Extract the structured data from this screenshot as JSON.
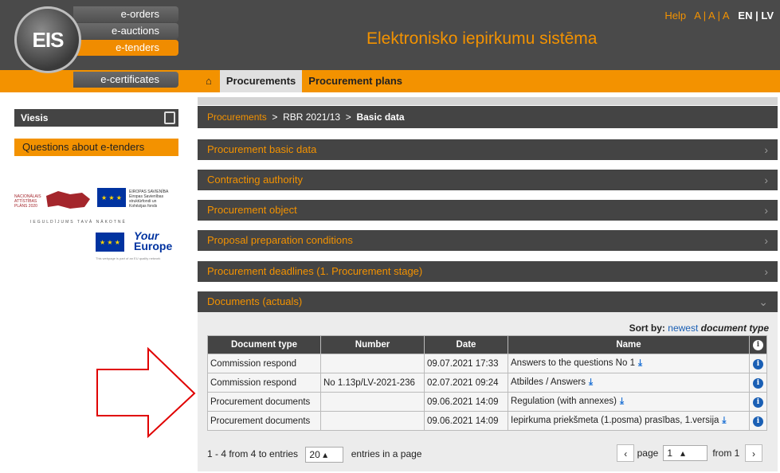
{
  "header": {
    "menu": [
      "e-orders",
      "e-auctions",
      "e-tenders"
    ],
    "certificates": "e-certificates",
    "logo_text": "EIS",
    "site_title": "Elektronisko iepirkumu sistēma",
    "help": "Help",
    "font_sizes": "A | A | A",
    "lang": "EN | LV"
  },
  "tabs": {
    "procurements": "Procurements",
    "plans": "Procurement plans"
  },
  "sidebar": {
    "user": "Viesis",
    "questions": "Questions about e-tenders",
    "eu_tagline": "IEGULDĪJUMS TAVĀ NĀKOTNĒ",
    "your_europe_top": "Your",
    "your_europe_bottom": "Europe",
    "your_europe_note": "This webpage is part of an EU quality network"
  },
  "breadcrumb": {
    "root": "Procurements",
    "id": "RBR 2021/13",
    "current": "Basic data",
    "sep": ">"
  },
  "sections": [
    "Procurement basic data",
    "Contracting authority",
    "Procurement object",
    "Proposal preparation conditions",
    "Procurement deadlines (1. Procurement stage)",
    "Documents (actuals)"
  ],
  "sort": {
    "label": "Sort by:",
    "newest": "newest",
    "document_type": "document type"
  },
  "table": {
    "headers": [
      "Document type",
      "Number",
      "Date",
      "Name"
    ],
    "rows": [
      {
        "type": "Commission respond",
        "number": "",
        "date": "09.07.2021 17:33",
        "name": "Answers to the questions No 1"
      },
      {
        "type": "Commission respond",
        "number": "No 1.13p/LV-2021-236",
        "date": "02.07.2021 09:24",
        "name": "Atbildes / Answers"
      },
      {
        "type": "Procurement documents",
        "number": "",
        "date": "09.06.2021 14:09",
        "name": "Regulation (with annexes)"
      },
      {
        "type": "Procurement documents",
        "number": "",
        "date": "09.06.2021 14:09",
        "name": "Iepirkuma priekšmeta (1.posma) prasības, 1.versija"
      }
    ]
  },
  "pager": {
    "summary": "1 - 4 from 4 to entries",
    "per_page": "20",
    "per_page_suffix": "entries in a page",
    "page_label": "page",
    "page": "1",
    "from": "from 1"
  },
  "colors": {
    "accent": "#f39200",
    "dark": "#444444",
    "arrow": "#e00000",
    "link": "#1a5fb4"
  }
}
